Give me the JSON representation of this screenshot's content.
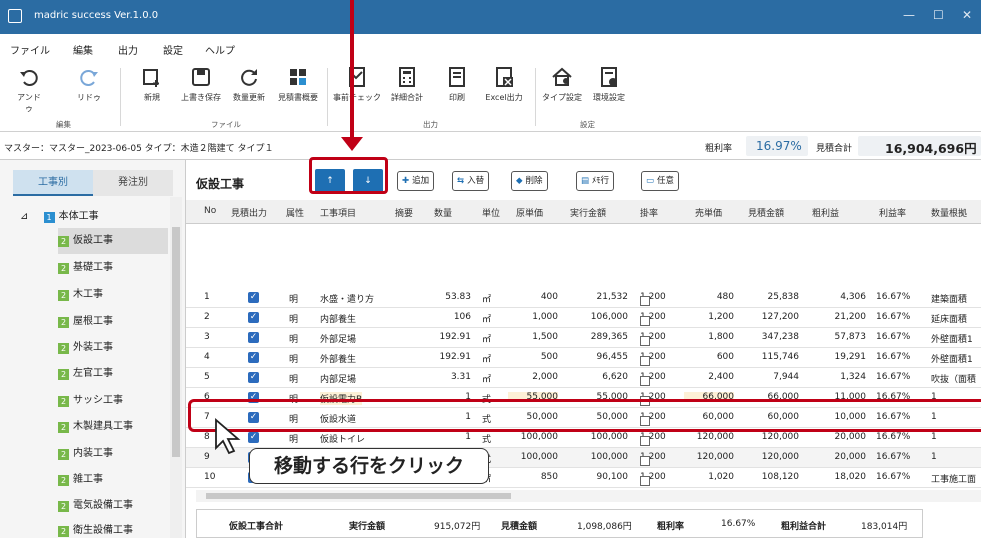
{
  "window": {
    "title": "madric success Ver.1.0.0",
    "min": "—",
    "max": "☐",
    "close": "✕"
  },
  "menu": [
    "ファイル",
    "編集",
    "出力",
    "設定",
    "ヘルプ"
  ],
  "ribbon": {
    "buttons": [
      "アンドゥ",
      "リドゥ",
      "新規",
      "上書き保存",
      "数量更新",
      "見積書概要",
      "事前チェック",
      "詳細合計",
      "印刷",
      "Excel出力",
      "タイプ設定",
      "環境設定"
    ],
    "groups": [
      "編集",
      "ファイル",
      "出力",
      "設定"
    ]
  },
  "info": {
    "master": "マスター：マスター_2023-06-05 タイプ：木造２階建て タイプ１",
    "margin_label": "粗利率",
    "margin_value": "16.97%",
    "total_label": "見積合計",
    "total_value": "16,904,696円"
  },
  "leftpane": {
    "tabs": [
      "工事別",
      "発注別"
    ],
    "root_badge": "1",
    "root_label": "本体工事",
    "items": [
      {
        "badge": "2",
        "label": "仮設工事"
      },
      {
        "badge": "2",
        "label": "基礎工事"
      },
      {
        "badge": "2",
        "label": "木工事"
      },
      {
        "badge": "2",
        "label": "屋根工事"
      },
      {
        "badge": "2",
        "label": "外装工事"
      },
      {
        "badge": "2",
        "label": "左官工事"
      },
      {
        "badge": "2",
        "label": "サッシ工事"
      },
      {
        "badge": "2",
        "label": "木製建具工事"
      },
      {
        "badge": "2",
        "label": "内装工事"
      },
      {
        "badge": "2",
        "label": "雑工事"
      },
      {
        "badge": "2",
        "label": "電気設備工事"
      },
      {
        "badge": "2",
        "label": "衛生設備工事"
      }
    ]
  },
  "main": {
    "section_title": "仮設工事",
    "nav_up": "↑",
    "nav_down": "↓",
    "toolbar": [
      {
        "icon": "✚",
        "label": "追加"
      },
      {
        "icon": "⇆",
        "label": "入替"
      },
      {
        "icon": "◆",
        "label": "削除"
      },
      {
        "icon": "▤",
        "label": "ﾒﾓ行"
      },
      {
        "icon": "▭",
        "label": "任意"
      }
    ],
    "columns": [
      "No",
      "見積出力",
      "属性",
      "工事項目",
      "摘要",
      "数量",
      "単位",
      "原単価",
      "実行金額",
      "掛率",
      "売単価",
      "見積金額",
      "粗利益",
      "利益率",
      "数量根拠"
    ],
    "rows": [
      {
        "no": "1",
        "attr": "明",
        "item": "水盛・遣り方",
        "qty": "53.83",
        "unit": "㎡",
        "cost": "400",
        "exec": "21,532",
        "rate": "1.200",
        "sell": "480",
        "est": "25,838",
        "profit": "4,306",
        "pct": "16.67%",
        "basis": "建築面積"
      },
      {
        "no": "2",
        "attr": "明",
        "item": "内部養生",
        "qty": "106",
        "unit": "㎡",
        "cost": "1,000",
        "exec": "106,000",
        "rate": "1.200",
        "sell": "1,200",
        "est": "127,200",
        "profit": "21,200",
        "pct": "16.67%",
        "basis": "延床面積"
      },
      {
        "no": "3",
        "attr": "明",
        "item": "外部足場",
        "qty": "192.91",
        "unit": "㎡",
        "cost": "1,500",
        "exec": "289,365",
        "rate": "1.200",
        "sell": "1,800",
        "est": "347,238",
        "profit": "57,873",
        "pct": "16.67%",
        "basis": "外壁面積1"
      },
      {
        "no": "4",
        "attr": "明",
        "item": "外部養生",
        "qty": "192.91",
        "unit": "㎡",
        "cost": "500",
        "exec": "96,455",
        "rate": "1.200",
        "sell": "600",
        "est": "115,746",
        "profit": "19,291",
        "pct": "16.67%",
        "basis": "外壁面積1"
      },
      {
        "no": "5",
        "attr": "明",
        "item": "内部足場",
        "qty": "3.31",
        "unit": "㎡",
        "cost": "2,000",
        "exec": "6,620",
        "rate": "1.200",
        "sell": "2,400",
        "est": "7,944",
        "profit": "1,324",
        "pct": "16.67%",
        "basis": "吹抜（面積"
      },
      {
        "no": "6",
        "attr": "明",
        "item": "仮設電力B",
        "qty": "1",
        "unit": "式",
        "cost": "55,000",
        "exec": "55,000",
        "rate": "1.200",
        "sell": "66,000",
        "est": "66,000",
        "profit": "11,000",
        "pct": "16.67%",
        "basis": "1"
      },
      {
        "no": "7",
        "attr": "明",
        "item": "仮設水道",
        "qty": "1",
        "unit": "式",
        "cost": "50,000",
        "exec": "50,000",
        "rate": "1.200",
        "sell": "60,000",
        "est": "60,000",
        "profit": "10,000",
        "pct": "16.67%",
        "basis": "1"
      },
      {
        "no": "8",
        "attr": "明",
        "item": "仮設トイレ",
        "qty": "1",
        "unit": "式",
        "cost": "100,000",
        "exec": "100,000",
        "rate": "1.200",
        "sell": "120,000",
        "est": "120,000",
        "profit": "20,000",
        "pct": "16.67%",
        "basis": "1"
      },
      {
        "no": "9",
        "attr": "明",
        "item": "運搬費",
        "qty": "1",
        "unit": "式",
        "cost": "100,000",
        "exec": "100,000",
        "rate": "1.200",
        "sell": "120,000",
        "est": "120,000",
        "profit": "20,000",
        "pct": "16.67%",
        "basis": "1"
      },
      {
        "no": "10",
        "attr": "明",
        "item": "片付け清掃費",
        "qty": "106",
        "unit": "㎡",
        "cost": "850",
        "exec": "90,100",
        "rate": "1.200",
        "sell": "1,020",
        "est": "108,120",
        "profit": "18,020",
        "pct": "16.67%",
        "basis": "工事施工面"
      }
    ],
    "totals": {
      "title": "仮設工事合計",
      "exec_label": "実行金額",
      "exec_value": "915,072円",
      "est_label": "見積金額",
      "est_value": "1,098,086円",
      "margin_label": "粗利率",
      "margin_value": "16.67%",
      "profit_label": "粗利益合計",
      "profit_value": "183,014円"
    }
  },
  "callout": "移動する行をクリック",
  "colors": {
    "titlebar": "#2b6ca3",
    "nav_button": "#1e6fb3",
    "annotation": "#c00016",
    "badge": "#78b84a"
  }
}
